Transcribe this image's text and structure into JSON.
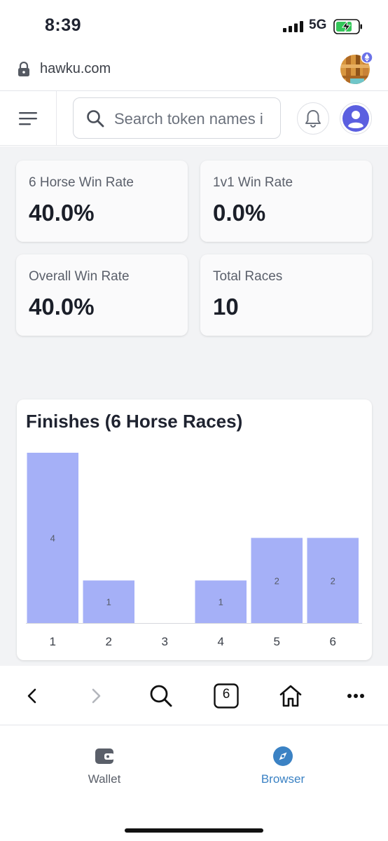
{
  "status_bar": {
    "time": "8:39",
    "network": "5G"
  },
  "browser": {
    "url": "hawku.com",
    "tab_count": "6"
  },
  "header": {
    "search_placeholder": "Search token names i"
  },
  "stats": [
    {
      "label": "6 Horse Win Rate",
      "value": "40.0%"
    },
    {
      "label": "1v1 Win Rate",
      "value": "0.0%"
    },
    {
      "label": "Overall Win Rate",
      "value": "40.0%"
    },
    {
      "label": "Total Races",
      "value": "10"
    }
  ],
  "chart_data": {
    "type": "bar",
    "title": "Finishes (6 Horse Races)",
    "categories": [
      "1",
      "2",
      "3",
      "4",
      "5",
      "6"
    ],
    "values": [
      4,
      1,
      0,
      1,
      2,
      2
    ],
    "data_labels": [
      "4",
      "1",
      "",
      "1",
      "2",
      "2"
    ],
    "ylim": [
      0,
      4
    ],
    "bar_color": "#a5b0f7",
    "grid": false
  },
  "tabs": [
    {
      "label": "Wallet",
      "active": false
    },
    {
      "label": "Browser",
      "active": true
    }
  ],
  "colors": {
    "accent": "#3b82c4",
    "bar": "#a5b0f7",
    "profile": "#5b5fe0",
    "inactive_tab": "#5a5f69"
  }
}
